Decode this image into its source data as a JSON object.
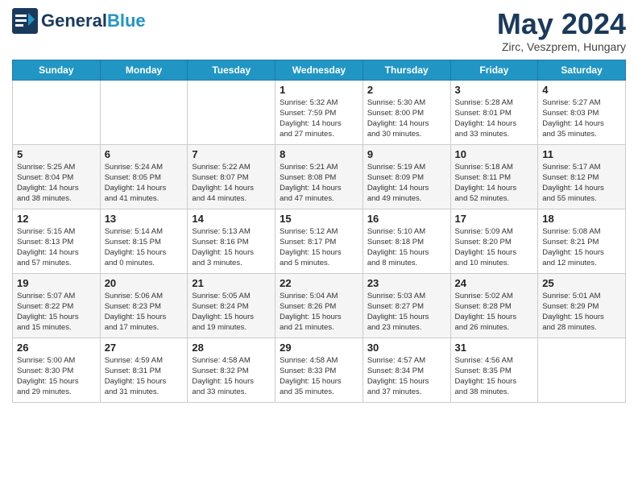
{
  "header": {
    "logo": {
      "line1": "General",
      "line2": "Blue"
    },
    "title": "May 2024",
    "location": "Zirc, Veszprem, Hungary"
  },
  "days_of_week": [
    "Sunday",
    "Monday",
    "Tuesday",
    "Wednesday",
    "Thursday",
    "Friday",
    "Saturday"
  ],
  "weeks": [
    [
      {
        "day": "",
        "detail": ""
      },
      {
        "day": "",
        "detail": ""
      },
      {
        "day": "",
        "detail": ""
      },
      {
        "day": "1",
        "detail": "Sunrise: 5:32 AM\nSunset: 7:59 PM\nDaylight: 14 hours\nand 27 minutes."
      },
      {
        "day": "2",
        "detail": "Sunrise: 5:30 AM\nSunset: 8:00 PM\nDaylight: 14 hours\nand 30 minutes."
      },
      {
        "day": "3",
        "detail": "Sunrise: 5:28 AM\nSunset: 8:01 PM\nDaylight: 14 hours\nand 33 minutes."
      },
      {
        "day": "4",
        "detail": "Sunrise: 5:27 AM\nSunset: 8:03 PM\nDaylight: 14 hours\nand 35 minutes."
      }
    ],
    [
      {
        "day": "5",
        "detail": "Sunrise: 5:25 AM\nSunset: 8:04 PM\nDaylight: 14 hours\nand 38 minutes."
      },
      {
        "day": "6",
        "detail": "Sunrise: 5:24 AM\nSunset: 8:05 PM\nDaylight: 14 hours\nand 41 minutes."
      },
      {
        "day": "7",
        "detail": "Sunrise: 5:22 AM\nSunset: 8:07 PM\nDaylight: 14 hours\nand 44 minutes."
      },
      {
        "day": "8",
        "detail": "Sunrise: 5:21 AM\nSunset: 8:08 PM\nDaylight: 14 hours\nand 47 minutes."
      },
      {
        "day": "9",
        "detail": "Sunrise: 5:19 AM\nSunset: 8:09 PM\nDaylight: 14 hours\nand 49 minutes."
      },
      {
        "day": "10",
        "detail": "Sunrise: 5:18 AM\nSunset: 8:11 PM\nDaylight: 14 hours\nand 52 minutes."
      },
      {
        "day": "11",
        "detail": "Sunrise: 5:17 AM\nSunset: 8:12 PM\nDaylight: 14 hours\nand 55 minutes."
      }
    ],
    [
      {
        "day": "12",
        "detail": "Sunrise: 5:15 AM\nSunset: 8:13 PM\nDaylight: 14 hours\nand 57 minutes."
      },
      {
        "day": "13",
        "detail": "Sunrise: 5:14 AM\nSunset: 8:15 PM\nDaylight: 15 hours\nand 0 minutes."
      },
      {
        "day": "14",
        "detail": "Sunrise: 5:13 AM\nSunset: 8:16 PM\nDaylight: 15 hours\nand 3 minutes."
      },
      {
        "day": "15",
        "detail": "Sunrise: 5:12 AM\nSunset: 8:17 PM\nDaylight: 15 hours\nand 5 minutes."
      },
      {
        "day": "16",
        "detail": "Sunrise: 5:10 AM\nSunset: 8:18 PM\nDaylight: 15 hours\nand 8 minutes."
      },
      {
        "day": "17",
        "detail": "Sunrise: 5:09 AM\nSunset: 8:20 PM\nDaylight: 15 hours\nand 10 minutes."
      },
      {
        "day": "18",
        "detail": "Sunrise: 5:08 AM\nSunset: 8:21 PM\nDaylight: 15 hours\nand 12 minutes."
      }
    ],
    [
      {
        "day": "19",
        "detail": "Sunrise: 5:07 AM\nSunset: 8:22 PM\nDaylight: 15 hours\nand 15 minutes."
      },
      {
        "day": "20",
        "detail": "Sunrise: 5:06 AM\nSunset: 8:23 PM\nDaylight: 15 hours\nand 17 minutes."
      },
      {
        "day": "21",
        "detail": "Sunrise: 5:05 AM\nSunset: 8:24 PM\nDaylight: 15 hours\nand 19 minutes."
      },
      {
        "day": "22",
        "detail": "Sunrise: 5:04 AM\nSunset: 8:26 PM\nDaylight: 15 hours\nand 21 minutes."
      },
      {
        "day": "23",
        "detail": "Sunrise: 5:03 AM\nSunset: 8:27 PM\nDaylight: 15 hours\nand 23 minutes."
      },
      {
        "day": "24",
        "detail": "Sunrise: 5:02 AM\nSunset: 8:28 PM\nDaylight: 15 hours\nand 26 minutes."
      },
      {
        "day": "25",
        "detail": "Sunrise: 5:01 AM\nSunset: 8:29 PM\nDaylight: 15 hours\nand 28 minutes."
      }
    ],
    [
      {
        "day": "26",
        "detail": "Sunrise: 5:00 AM\nSunset: 8:30 PM\nDaylight: 15 hours\nand 29 minutes."
      },
      {
        "day": "27",
        "detail": "Sunrise: 4:59 AM\nSunset: 8:31 PM\nDaylight: 15 hours\nand 31 minutes."
      },
      {
        "day": "28",
        "detail": "Sunrise: 4:58 AM\nSunset: 8:32 PM\nDaylight: 15 hours\nand 33 minutes."
      },
      {
        "day": "29",
        "detail": "Sunrise: 4:58 AM\nSunset: 8:33 PM\nDaylight: 15 hours\nand 35 minutes."
      },
      {
        "day": "30",
        "detail": "Sunrise: 4:57 AM\nSunset: 8:34 PM\nDaylight: 15 hours\nand 37 minutes."
      },
      {
        "day": "31",
        "detail": "Sunrise: 4:56 AM\nSunset: 8:35 PM\nDaylight: 15 hours\nand 38 minutes."
      },
      {
        "day": "",
        "detail": ""
      }
    ]
  ]
}
